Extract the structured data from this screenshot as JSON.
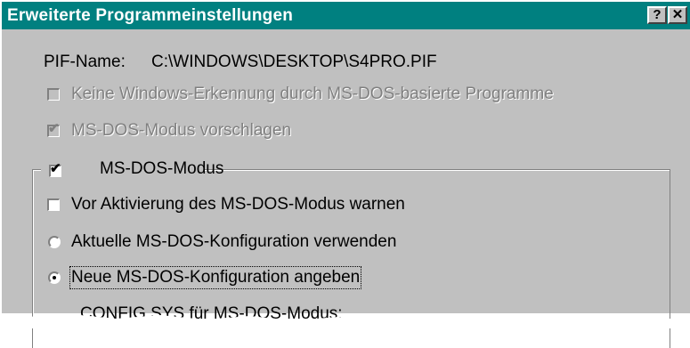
{
  "window": {
    "title": "Erweiterte Programmeinstellungen",
    "help_button": "?",
    "close_button": "✕"
  },
  "pif": {
    "label": "PIF-Name:",
    "value": "C:\\WINDOWS\\DESKTOP\\S4PRO.PIF"
  },
  "options": {
    "no_windows_detection": {
      "label": "Keine Windows-Erkennung durch MS-DOS-basierte Programme",
      "checked": false,
      "enabled": false
    },
    "suggest_dos_mode": {
      "label": "MS-DOS-Modus vorschlagen",
      "checked": true,
      "enabled": false
    },
    "dos_mode": {
      "label": "MS-DOS-Modus",
      "checked": true,
      "enabled": true
    },
    "warn_before_dos": {
      "label": "Vor Aktivierung des MS-DOS-Modus warnen",
      "checked": false,
      "enabled": true
    }
  },
  "config": {
    "current": {
      "label": "Aktuelle MS-DOS-Konfiguration verwenden",
      "selected": false
    },
    "new": {
      "label": "Neue MS-DOS-Konfiguration angeben",
      "selected": true
    },
    "config_sys_label": "CONFIG.SYS für MS-DOS-Modus:"
  },
  "colors": {
    "titlebar": "#008080",
    "face": "#c0c0c0",
    "disabled_text": "#808080"
  },
  "icons": {
    "help": "help-icon",
    "close": "close-icon",
    "checkmark": "checkmark-icon",
    "radio_dot": "radio-dot-icon"
  }
}
